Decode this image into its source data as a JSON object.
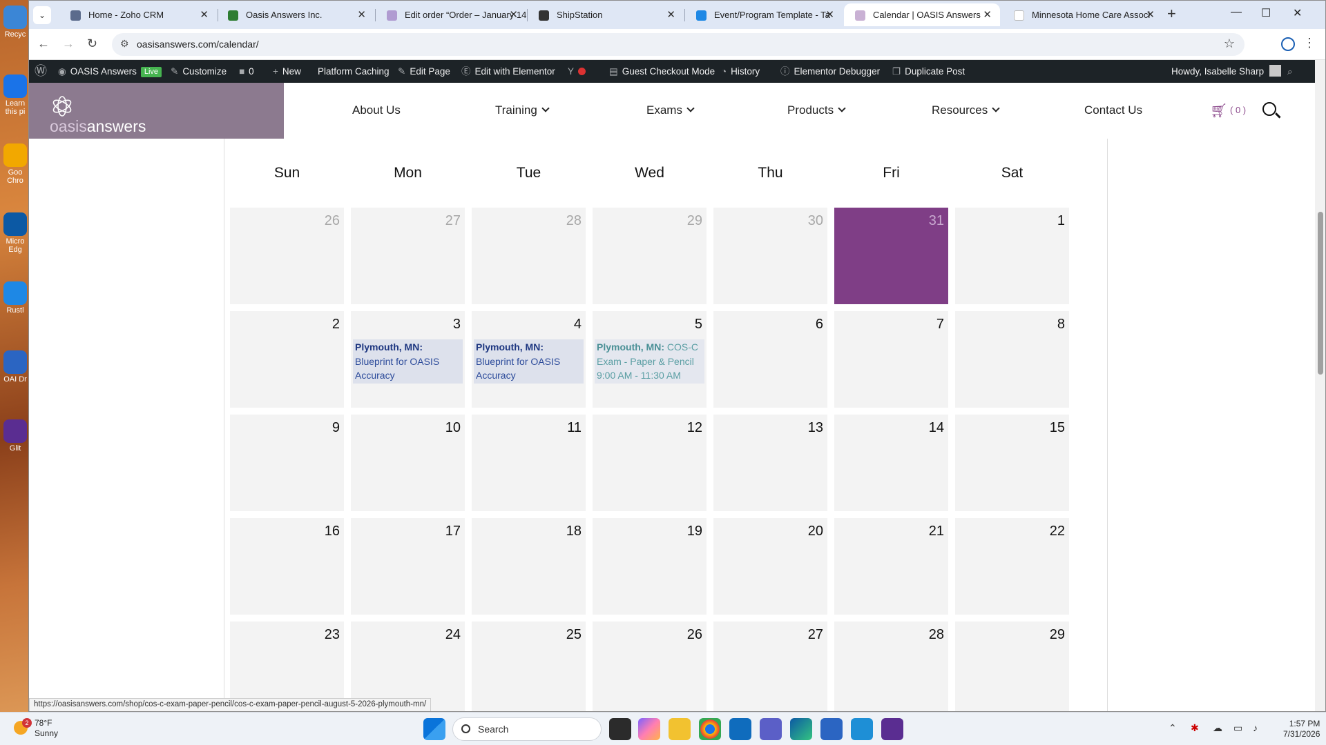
{
  "browser": {
    "tabs": [
      {
        "label": "Home - Zoho CRM",
        "fav_color": "#5b6b8c"
      },
      {
        "label": "Oasis Answers Inc.",
        "fav_color": "#2e7d32"
      },
      {
        "label": "Edit order “Order – January 14",
        "fav_color": "#b09bd1"
      },
      {
        "label": "ShipStation",
        "fav_color": "#333333"
      },
      {
        "label": "Event/Program Template - Ta",
        "fav_color": "#1e88e5"
      },
      {
        "label": "Calendar | OASIS Answers",
        "fav_color": "#c9b1d4"
      },
      {
        "label": "Minnesota Home Care Associ",
        "fav_color": "#ffffff"
      }
    ],
    "url": "oasisanswers.com/calendar/"
  },
  "adminbar": {
    "site_name": "OASIS Answers",
    "live_label": "Live",
    "customize": "Customize",
    "comments_count": "0",
    "new_label": "New",
    "platform_caching": "Platform Caching",
    "edit_page": "Edit Page",
    "edit_elementor": "Edit with Elementor",
    "guest_checkout": "Guest Checkout Mode",
    "history": "History",
    "elementor_debugger": "Elementor Debugger",
    "duplicate_post": "Duplicate Post",
    "howdy": "Howdy, Isabelle Sharp"
  },
  "site": {
    "logo_oasis": "oasis",
    "logo_answers": "answers",
    "menu": [
      "About Us",
      "Training",
      "Exams",
      "Products",
      "Resources",
      "Contact Us"
    ],
    "cart_count": "( 0 )",
    "brand_color": "#7f3e86"
  },
  "calendar": {
    "weekdays": [
      "Sun",
      "Mon",
      "Tue",
      "Wed",
      "Thu",
      "Fri",
      "Sat"
    ],
    "weeks": [
      [
        {
          "n": "26",
          "other": true
        },
        {
          "n": "27",
          "other": true
        },
        {
          "n": "28",
          "other": true
        },
        {
          "n": "29",
          "other": true
        },
        {
          "n": "30",
          "other": true
        },
        {
          "n": "31",
          "other": true,
          "today": true
        },
        {
          "n": "1"
        }
      ],
      [
        {
          "n": "2"
        },
        {
          "n": "3",
          "event": {
            "loc": "Plymouth, MN:",
            "title": "Blueprint for OASIS Accuracy",
            "style": "blue"
          }
        },
        {
          "n": "4",
          "event": {
            "loc": "Plymouth, MN:",
            "title": "Blueprint for OASIS Accuracy",
            "style": "blue"
          }
        },
        {
          "n": "5",
          "event": {
            "loc": "Plymouth, MN:",
            "title": "COS-C Exam - Paper & Pencil 9:00 AM - 11:30 AM",
            "style": "teal"
          }
        },
        {
          "n": "6"
        },
        {
          "n": "7"
        },
        {
          "n": "8"
        }
      ],
      [
        {
          "n": "9"
        },
        {
          "n": "10"
        },
        {
          "n": "11"
        },
        {
          "n": "12"
        },
        {
          "n": "13"
        },
        {
          "n": "14"
        },
        {
          "n": "15"
        }
      ],
      [
        {
          "n": "16"
        },
        {
          "n": "17"
        },
        {
          "n": "18"
        },
        {
          "n": "19"
        },
        {
          "n": "20"
        },
        {
          "n": "21"
        },
        {
          "n": "22"
        }
      ],
      [
        {
          "n": "23"
        },
        {
          "n": "24"
        },
        {
          "n": "25"
        },
        {
          "n": "26"
        },
        {
          "n": "27"
        },
        {
          "n": "28"
        },
        {
          "n": "29"
        }
      ]
    ]
  },
  "status_url": "https://oasisanswers.com/shop/cos-c-exam-paper-pencil/cos-c-exam-paper-pencil-august-5-2026-plymouth-mn/",
  "taskbar": {
    "temp": "78°F",
    "condition": "Sunny",
    "weather_badge": "2",
    "search_label": "Search",
    "time": "1:57 PM",
    "date": "7/31/2026"
  },
  "desktop_icons": [
    "Recyc",
    "Learn this pi",
    "Goo Chro",
    "Micro Edg",
    "Rustl",
    "OAI Dr",
    "Glit"
  ]
}
